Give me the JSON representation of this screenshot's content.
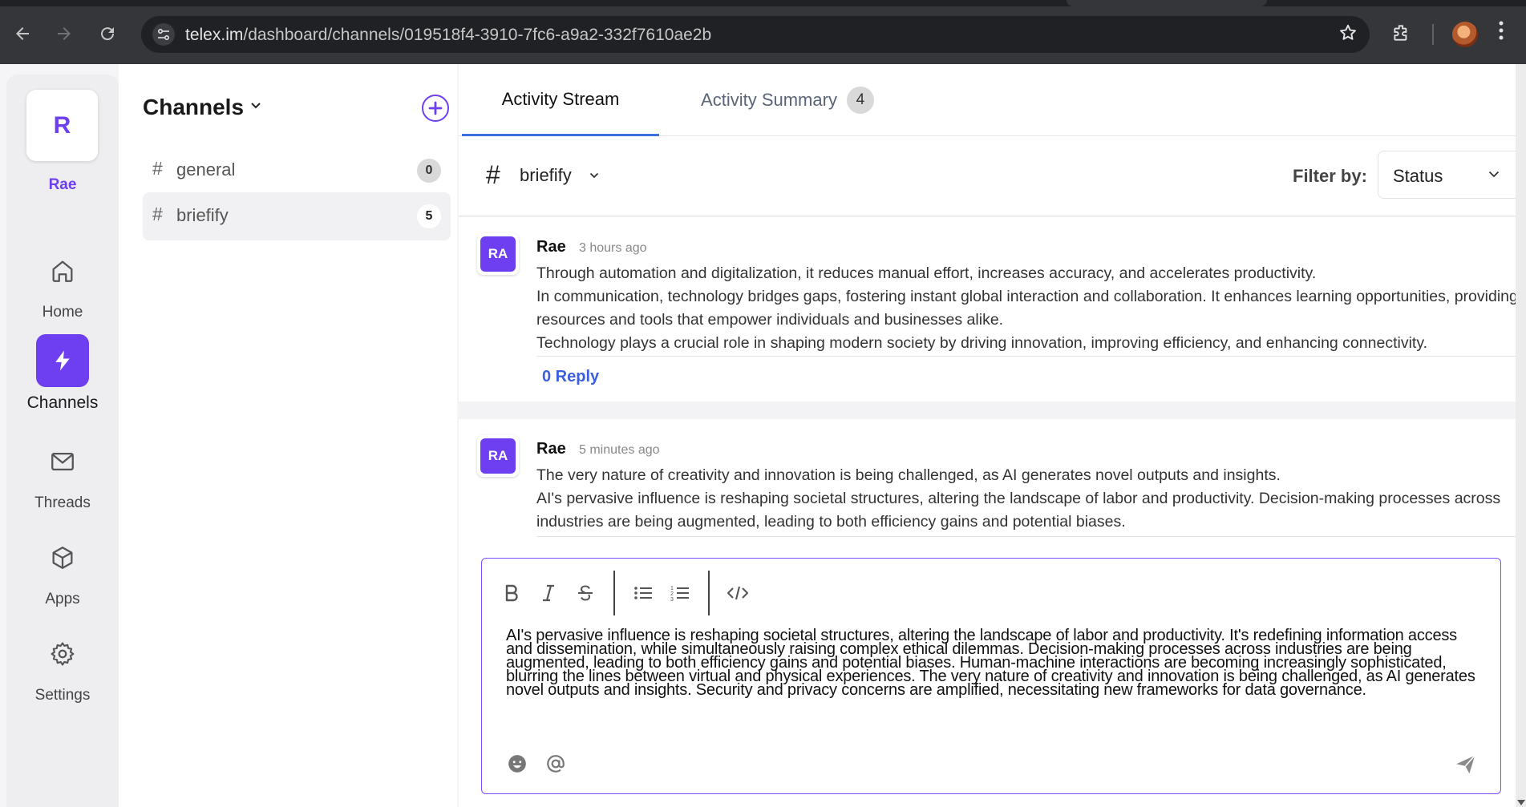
{
  "browser": {
    "url_host": "telex.im",
    "url_path": "/dashboard/channels/019518f4-3910-7fc6-a9a2-332f7610ae2b"
  },
  "org": {
    "initial": "R",
    "name": "Rae"
  },
  "rail": {
    "items": [
      {
        "label": "Home",
        "icon": "home-icon"
      },
      {
        "label": "Channels",
        "icon": "bolt-icon"
      },
      {
        "label": "Threads",
        "icon": "mail-icon"
      },
      {
        "label": "Apps",
        "icon": "cube-icon"
      },
      {
        "label": "Settings",
        "icon": "gear-icon"
      }
    ],
    "active_item": "Channels"
  },
  "channels_panel": {
    "title": "Channels",
    "items": [
      {
        "hash": "#",
        "name": "general",
        "count": "0"
      },
      {
        "hash": "#",
        "name": "briefify",
        "count": "5"
      }
    ]
  },
  "tabs": {
    "activity_stream": "Activity Stream",
    "activity_summary": "Activity Summary",
    "summary_badge": "4"
  },
  "subbar": {
    "hash": "#",
    "channel": "briefify",
    "filter_label": "Filter by:",
    "filter_value": "Status"
  },
  "messages": [
    {
      "avatar": "RA",
      "author": "Rae",
      "time": "3 hours ago",
      "lines": [
        "Through automation and digitalization, it reduces manual effort, increases accuracy, and accelerates productivity.",
        "In communication, technology bridges gaps, fostering instant global interaction and collaboration. It enhances learning opportunities, providing resources and tools that empower individuals and businesses alike.",
        "Technology plays a crucial role in shaping modern society by driving innovation, improving efficiency, and enhancing connectivity."
      ],
      "reply": "0 Reply"
    },
    {
      "avatar": "RA",
      "author": "Rae",
      "time": "5 minutes ago",
      "lines": [
        "The very nature of creativity and innovation is being challenged, as AI generates novel outputs and insights.",
        "AI's pervasive influence is reshaping societal structures, altering the landscape of labor and productivity. Decision-making processes across industries are being augmented, leading to both efficiency gains and potential biases."
      ]
    }
  ],
  "composer": {
    "text": "AI's pervasive influence is reshaping societal structures, altering the landscape of labor and productivity. It's redefining information access and dissemination, while simultaneously raising complex ethical dilemmas. Decision-making processes across industries are being augmented, leading to both efficiency gains and potential biases. Human-machine interactions are becoming increasingly sophisticated, blurring the lines between virtual and physical experiences. The very nature of creativity and innovation is being challenged, as AI generates novel outputs and insights. Security and privacy concerns are amplified, necessitating new frameworks for data governance."
  },
  "colors": {
    "accent": "#6d3ff0",
    "link": "#3c5fe0",
    "tab_underline": "#3c6fe0"
  }
}
